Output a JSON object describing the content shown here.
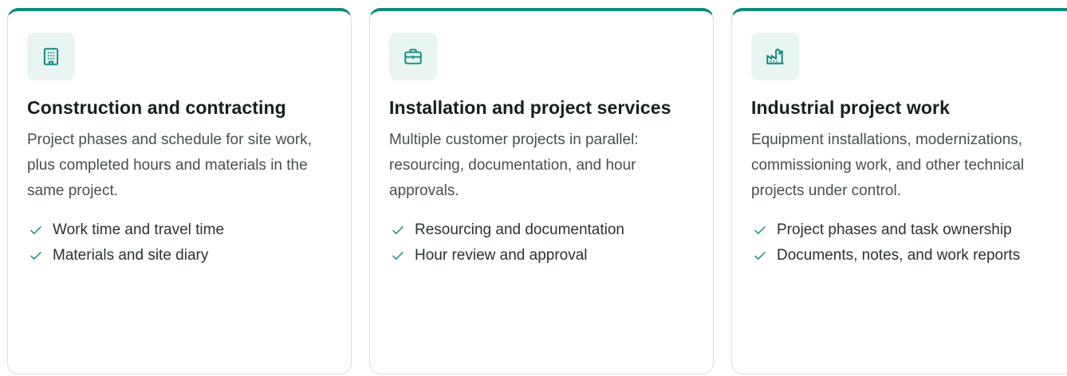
{
  "theme": {
    "accent": "#0e8c7c",
    "icon_bg": "#e8f5f2",
    "border": "#d9dfdc"
  },
  "cards": [
    {
      "icon": "building-icon",
      "title": "Construction and contracting",
      "description": "Project phases and schedule for site work, plus completed hours and materials in the same project.",
      "features": [
        "Work time and travel time",
        "Materials and site diary"
      ]
    },
    {
      "icon": "briefcase-icon",
      "title": "Installation and project services",
      "description": "Multiple customer projects in parallel: resourcing, documentation, and hour approvals.",
      "features": [
        "Resourcing and documentation",
        "Hour review and approval"
      ]
    },
    {
      "icon": "factory-icon",
      "title": "Industrial project work",
      "description": "Equipment installations, modernizations, commissioning work, and other technical projects under control.",
      "features": [
        "Project phases and task ownership",
        "Documents, notes, and work reports"
      ]
    }
  ]
}
